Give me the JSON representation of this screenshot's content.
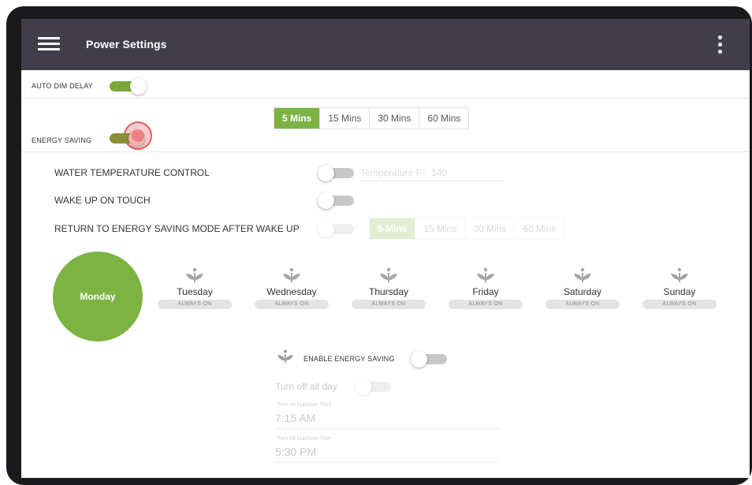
{
  "app": {
    "title": "Power Settings",
    "menu_icon": "hamburger-menu-icon",
    "more_icon": "more-vert-icon",
    "accent_color": "#7cb342",
    "appbar_color": "#413e4a"
  },
  "auto_dim": {
    "label": "AUTO DIM DELAY",
    "enabled": true
  },
  "dim_delay": {
    "options": [
      "5 Mins",
      "15 Mins",
      "30 Mins",
      "60 Mins"
    ],
    "selected": "5 Mins"
  },
  "energy_saving": {
    "label": "ENERGY SAVING",
    "enabled": true
  },
  "controls": {
    "water_temp": {
      "label": "WATER TEMPERATURE CONTROL",
      "enabled": false,
      "temp_label": "Temperature F°",
      "temp_value": "140"
    },
    "wake_on_touch": {
      "label": "WAKE UP ON TOUCH",
      "enabled": false
    },
    "return_mode": {
      "label": "RETURN TO ENERGY SAVING MODE AFTER WAKE UP",
      "enabled": false,
      "options": [
        "5 Mins",
        "15 Mins",
        "30 Mins",
        "60 Mins"
      ],
      "selected": "5 Mins"
    }
  },
  "schedule": {
    "selected_day": "Monday",
    "plant_icon": "plant-sprout-icon",
    "days": [
      {
        "name": "Tuesday",
        "status": "ALWAYS ON"
      },
      {
        "name": "Wednesday",
        "status": "ALWAYS ON"
      },
      {
        "name": "Thursday",
        "status": "ALWAYS ON"
      },
      {
        "name": "Friday",
        "status": "ALWAYS ON"
      },
      {
        "name": "Saturday",
        "status": "ALWAYS ON"
      },
      {
        "name": "Sunday",
        "status": "ALWAYS ON"
      }
    ]
  },
  "day_settings": {
    "enable_label": "ENABLE ENERGY SAVING",
    "enable_on": false,
    "turn_off_label": "Turn off all day",
    "turn_on_time_label": "Turn on Machine Time",
    "turn_on_time": "7:15 AM",
    "turn_off_time_label": "Turn off Machine Time",
    "turn_off_time": "5:30 PM"
  }
}
